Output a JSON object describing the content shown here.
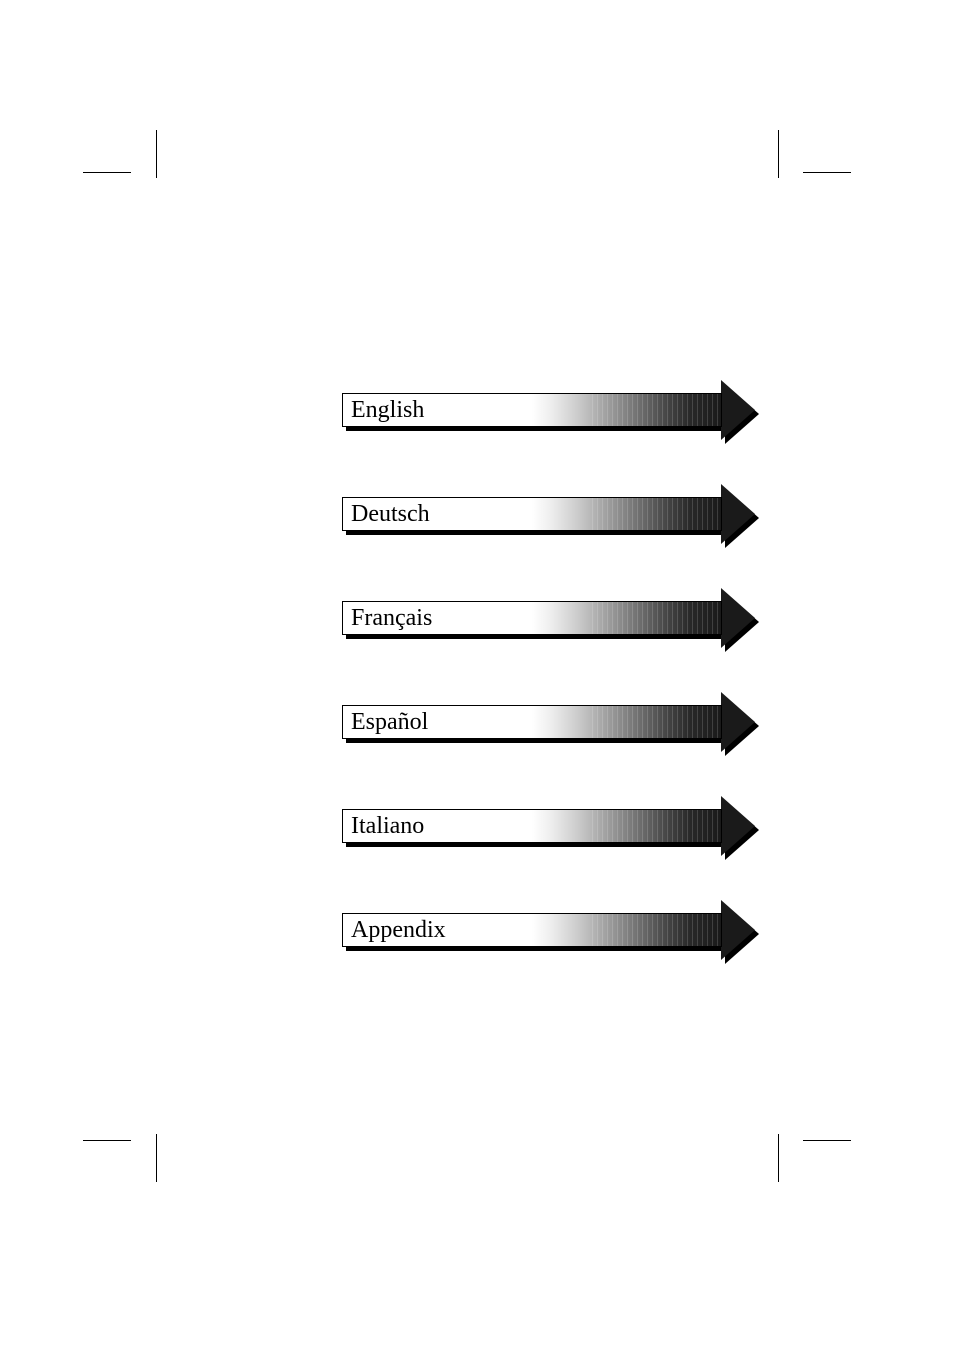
{
  "sections": [
    {
      "label": "English"
    },
    {
      "label": "Deutsch"
    },
    {
      "label": "Français"
    },
    {
      "label": "Español"
    },
    {
      "label": "Italiano"
    },
    {
      "label": "Appendix"
    }
  ]
}
